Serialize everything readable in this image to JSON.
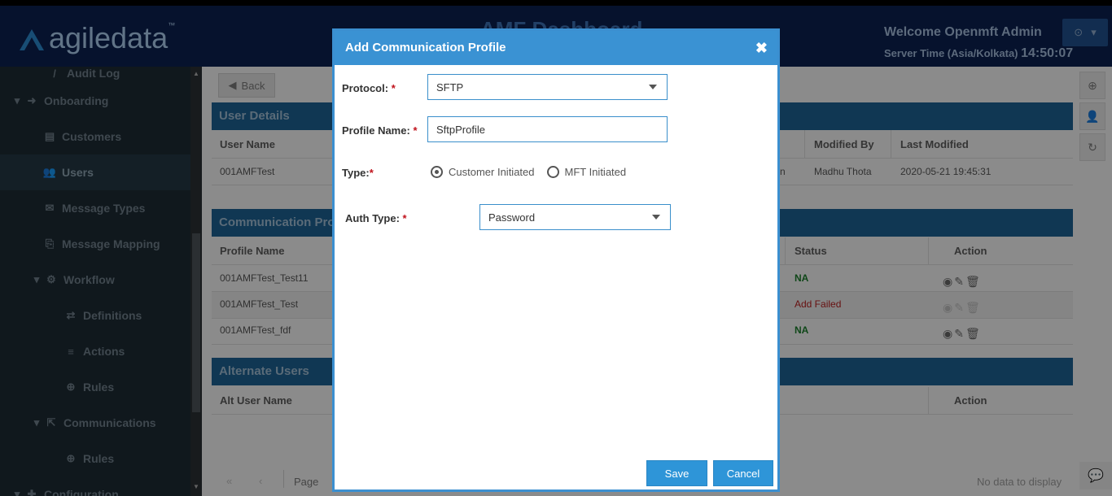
{
  "header": {
    "logo_text": "agiledata",
    "logo_tm": "™",
    "dashboard_title": "AMF Dashboard",
    "welcome": "Welcome Openmft Admin",
    "server_time_label": "Server Time (Asia/Kolkata)",
    "server_time": "14:50:07"
  },
  "sidebar": {
    "items": [
      {
        "label": "Audit Log",
        "icon": "audit-icon"
      },
      {
        "label": "Onboarding",
        "icon": "signin-icon"
      },
      {
        "label": "Customers",
        "icon": "id-card-icon"
      },
      {
        "label": "Users",
        "icon": "users-icon"
      },
      {
        "label": "Message Types",
        "icon": "envelope-icon"
      },
      {
        "label": "Message Mapping",
        "icon": "file-code-icon"
      },
      {
        "label": "Workflow",
        "icon": "gear-icon"
      },
      {
        "label": "Definitions",
        "icon": "exchange-icon"
      },
      {
        "label": "Actions",
        "icon": "bars-icon"
      },
      {
        "label": "Rules",
        "icon": "arrow-circle-icon"
      },
      {
        "label": "Communications",
        "icon": "share-icon"
      },
      {
        "label": "Rules",
        "icon": "arrow-circle-icon"
      },
      {
        "label": "Configuration",
        "icon": "plus-icon"
      }
    ]
  },
  "main": {
    "back_label": "Back",
    "user_details": {
      "title": "User Details",
      "columns": [
        "User Name",
        "Modified By",
        "Last Modified"
      ],
      "row": {
        "user_name": "001AMFTest",
        "partial": "n",
        "modified_by": "Madhu Thota",
        "last_modified": "2020-05-21 19:45:31"
      }
    },
    "comm_profiles": {
      "title": "Communication Profi",
      "columns": [
        "Profile Name",
        "Status",
        "Action"
      ],
      "rows": [
        {
          "name": "001AMFTest_Test11",
          "status": "NA"
        },
        {
          "name": "001AMFTest_Test",
          "status": "Add Failed"
        },
        {
          "name": "001AMFTest_fdf",
          "status": "NA"
        }
      ]
    },
    "alt_users": {
      "title": "Alternate Users",
      "columns": [
        "Alt User Name",
        "Action"
      ]
    },
    "pager": {
      "page_label": "Page",
      "no_data": "No data to display"
    }
  },
  "modal": {
    "title": "Add Communication Profile",
    "close": "✖",
    "protocol_label": "Protocol:",
    "protocol_value": "SFTP",
    "profile_name_label": "Profile Name:",
    "profile_name_value": "SftpProfile",
    "type_label": "Type:",
    "type_options": [
      "Customer Initiated",
      "MFT Initiated"
    ],
    "type_selected": "Customer Initiated",
    "auth_type_label": "Auth Type:",
    "auth_type_value": "Password",
    "required_mark": "*",
    "save_label": "Save",
    "cancel_label": "Cancel"
  },
  "colors": {
    "header_bg": "#0b1f4f",
    "sidebar_bg": "#1d2a33",
    "section_bg": "#1d5f8f",
    "modal_accent": "#3a92d3",
    "status_ok": "#1a7a2a",
    "status_fail": "#b21e1e"
  }
}
